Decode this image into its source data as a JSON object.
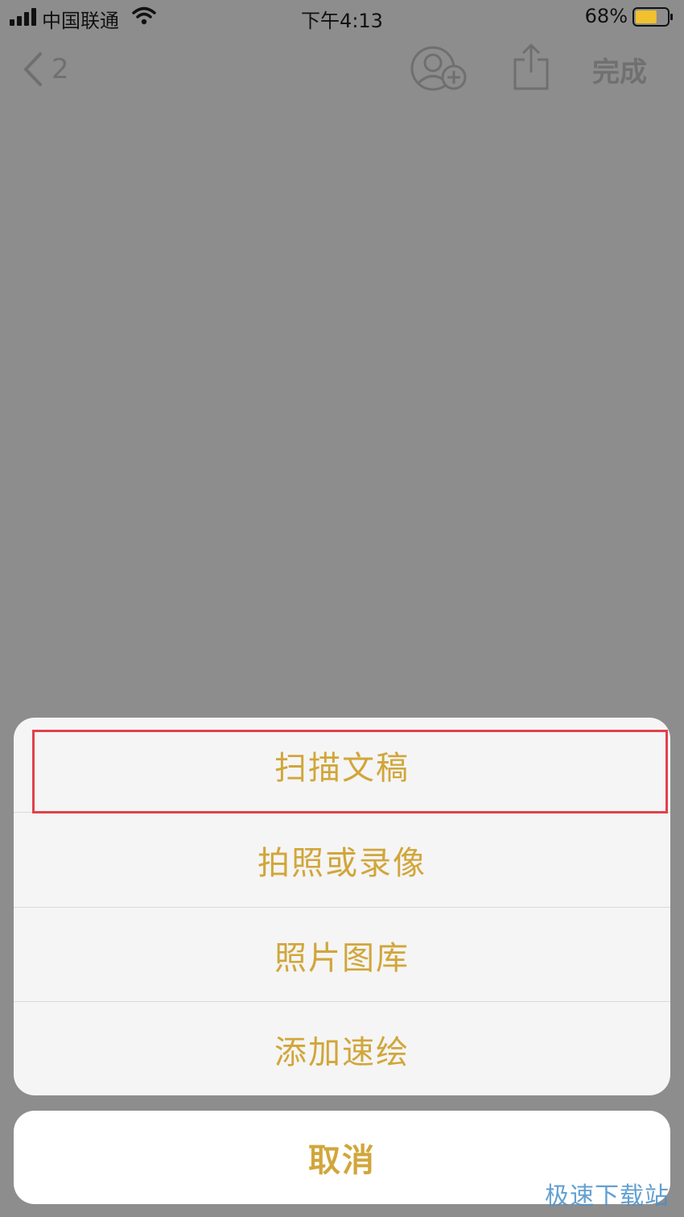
{
  "status_bar": {
    "carrier": "中国联通",
    "time": "下午4:13",
    "battery_percent": "68%",
    "battery_level": 0.68,
    "battery_color": "#f2c12e"
  },
  "nav": {
    "back_count": "2",
    "done_label": "完成",
    "icons": [
      "back-chevron-icon",
      "add-person-icon",
      "share-icon"
    ]
  },
  "action_sheet": {
    "items": [
      {
        "label": "扫描文稿",
        "highlighted": true
      },
      {
        "label": "拍照或录像"
      },
      {
        "label": "照片图库"
      },
      {
        "label": "添加速绘"
      }
    ],
    "cancel_label": "取消",
    "accent_color": "#d1a63a",
    "highlight_color": "#e0424c"
  },
  "watermark": "极速下载站"
}
